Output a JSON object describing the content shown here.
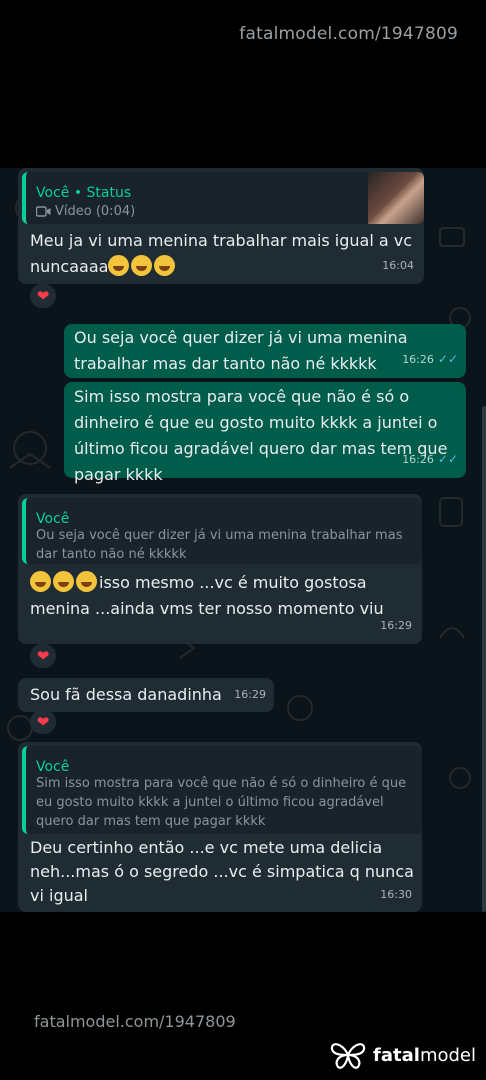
{
  "watermark_top": "fatalmodel.com/1947809",
  "watermark_bottom": "fatalmodel.com/1947809",
  "brand": {
    "bold": "fatal",
    "light": "model"
  },
  "messages": {
    "m1": {
      "quote_author": "Você • Status",
      "quote_text": "Vídeo (0:04)",
      "text": "Meu ja vi uma menina trabalhar mais igual a vc nuncaaaa",
      "time": "16:04",
      "reaction": "❤"
    },
    "m2": {
      "text": "Ou seja você quer dizer já vi uma menina trabalhar mas dar tanto não né kkkkk",
      "time": "16:26",
      "ticks": "✓✓"
    },
    "m3": {
      "text": "Sim isso mostra para você que não é só o dinheiro é que eu gosto muito kkkk a juntei o último ficou agradável quero dar mas tem que pagar kkkk",
      "time": "16:26",
      "ticks": "✓✓"
    },
    "m4": {
      "quote_author": "Você",
      "quote_text": "Ou seja você quer dizer já vi uma menina trabalhar mas dar tanto não né kkkkk",
      "text": "isso mesmo ...vc é muito gostosa menina ...ainda vms ter nosso momento viu",
      "time": "16:29",
      "reaction": "❤"
    },
    "m5": {
      "text": "Sou fã dessa danadinha",
      "time": "16:29",
      "reaction": "❤"
    },
    "m6": {
      "quote_author": "Você",
      "quote_text": "Sim isso mostra para você que não é só o dinheiro é que eu gosto muito kkkk a juntei o último ficou agradável quero dar mas tem que pagar kkkk",
      "text": "Deu certinho então ...e vc mete uma delicia neh...mas ó o segredo ...vc é simpatica q nunca vi igual",
      "time": "16:30"
    }
  },
  "icons": {
    "video": "video-camera-icon",
    "emoji": "rolling-laughing-emoji",
    "heart": "red-heart-icon",
    "logo": "butterfly-logo-icon"
  },
  "colors": {
    "chat_bg": "#0b141a",
    "incoming": "#202c33",
    "outgoing": "#005c4b",
    "accent": "#06cf9c",
    "tick_blue": "#53bdeb"
  }
}
